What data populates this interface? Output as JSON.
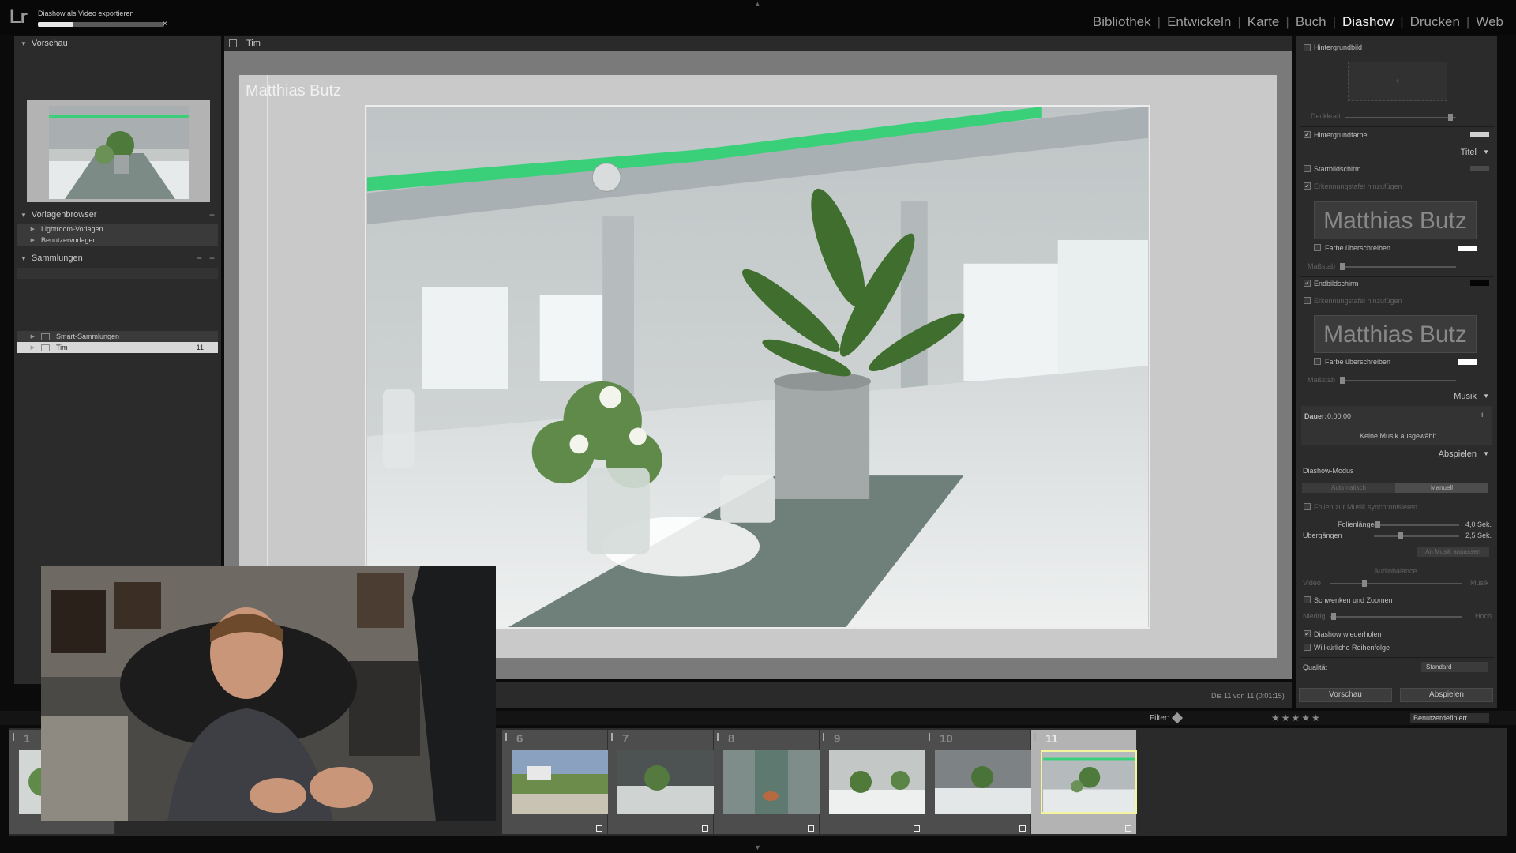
{
  "progress": {
    "title": "Diashow als Video exportieren",
    "fraction": 0.28,
    "close": "×"
  },
  "app": {
    "logo": "Lr"
  },
  "modules": [
    "Bibliothek",
    "Entwickeln",
    "Karte",
    "Buch",
    "Diashow",
    "Drucken",
    "Web"
  ],
  "active_module": "Diashow",
  "left": {
    "preview_header": "Vorschau",
    "templates_header": "Vorlagenbrowser",
    "templates": [
      "Lightroom-Vorlagen",
      "Benutzervorlagen"
    ],
    "collections_header": "Sammlungen",
    "collections": [
      {
        "label": "Smart-Sammlungen",
        "count": ""
      },
      {
        "label": "Tim",
        "count": "11"
      }
    ],
    "add": "+",
    "remove": "−"
  },
  "center": {
    "collection_name": "Tim",
    "slide_title": "Matthias Butz",
    "slide_counter": "Dia 11 von 11 (0:01:15)"
  },
  "right": {
    "hintergrundbild": "Hintergrundbild",
    "deckkraft": "Deckkraft",
    "hintergrundfarbe": "Hintergrundfarbe",
    "titel": "Titel",
    "startbildschirm": "Startbildschirm",
    "erkennungstafel_start": "Erkennungstafel hinzufügen",
    "identity_plate": "Matthias Butz",
    "farbe_ueberschreiben": "Farbe überschreiben",
    "masstab": "Maßstab",
    "endbildschirm": "Endbildschirm",
    "erkennungstafel_end": "Erkennungstafel hinzufügen",
    "musik": "Musik",
    "dauer_label": "Dauer:",
    "dauer_value": "0:00:00",
    "keine_musik": "Keine Musik ausgewählt",
    "abspielen": "Abspielen",
    "modus": "Diashow-Modus",
    "automatisch": "Automatisch",
    "manuell": "Manuell",
    "folien_musik": "Folien zur Musik synchronisieren",
    "folienlaenge": "Folienlänge",
    "folienlaenge_value": "4,0 Sek.",
    "uebergaenge": "Übergängen",
    "uebergaenge_value": "2,5 Sek.",
    "an_musik": "An Musik anpassen",
    "audiobalance": "Audiobalance",
    "video": "Video",
    "musik_lbl": "Musik",
    "schwenken": "Schwenken und Zoomen",
    "niedrig": "Niedrig",
    "hoch": "Hoch",
    "wiederholen": "Diashow wiederholen",
    "willkuerlich": "Willkürliche Reihenfolge",
    "qualitaet": "Qualität",
    "qualitaet_value": "Standard",
    "vorschau_btn": "Vorschau",
    "abspielen_btn": "Abspielen"
  },
  "filmstrip": {
    "filter_label": "Filter:",
    "stars": "★★★★★",
    "preset": "Benutzerdefiniert...",
    "frames": [
      "1",
      "6",
      "7",
      "8",
      "9",
      "10",
      "11"
    ],
    "selected": "11"
  },
  "icons": {
    "collapse": "triangle-down-icon",
    "flag": "flag-icon",
    "star": "star-icon"
  },
  "colors": {
    "accent_green": "#3ad07a",
    "selected_cell": "#b3b3b3"
  }
}
